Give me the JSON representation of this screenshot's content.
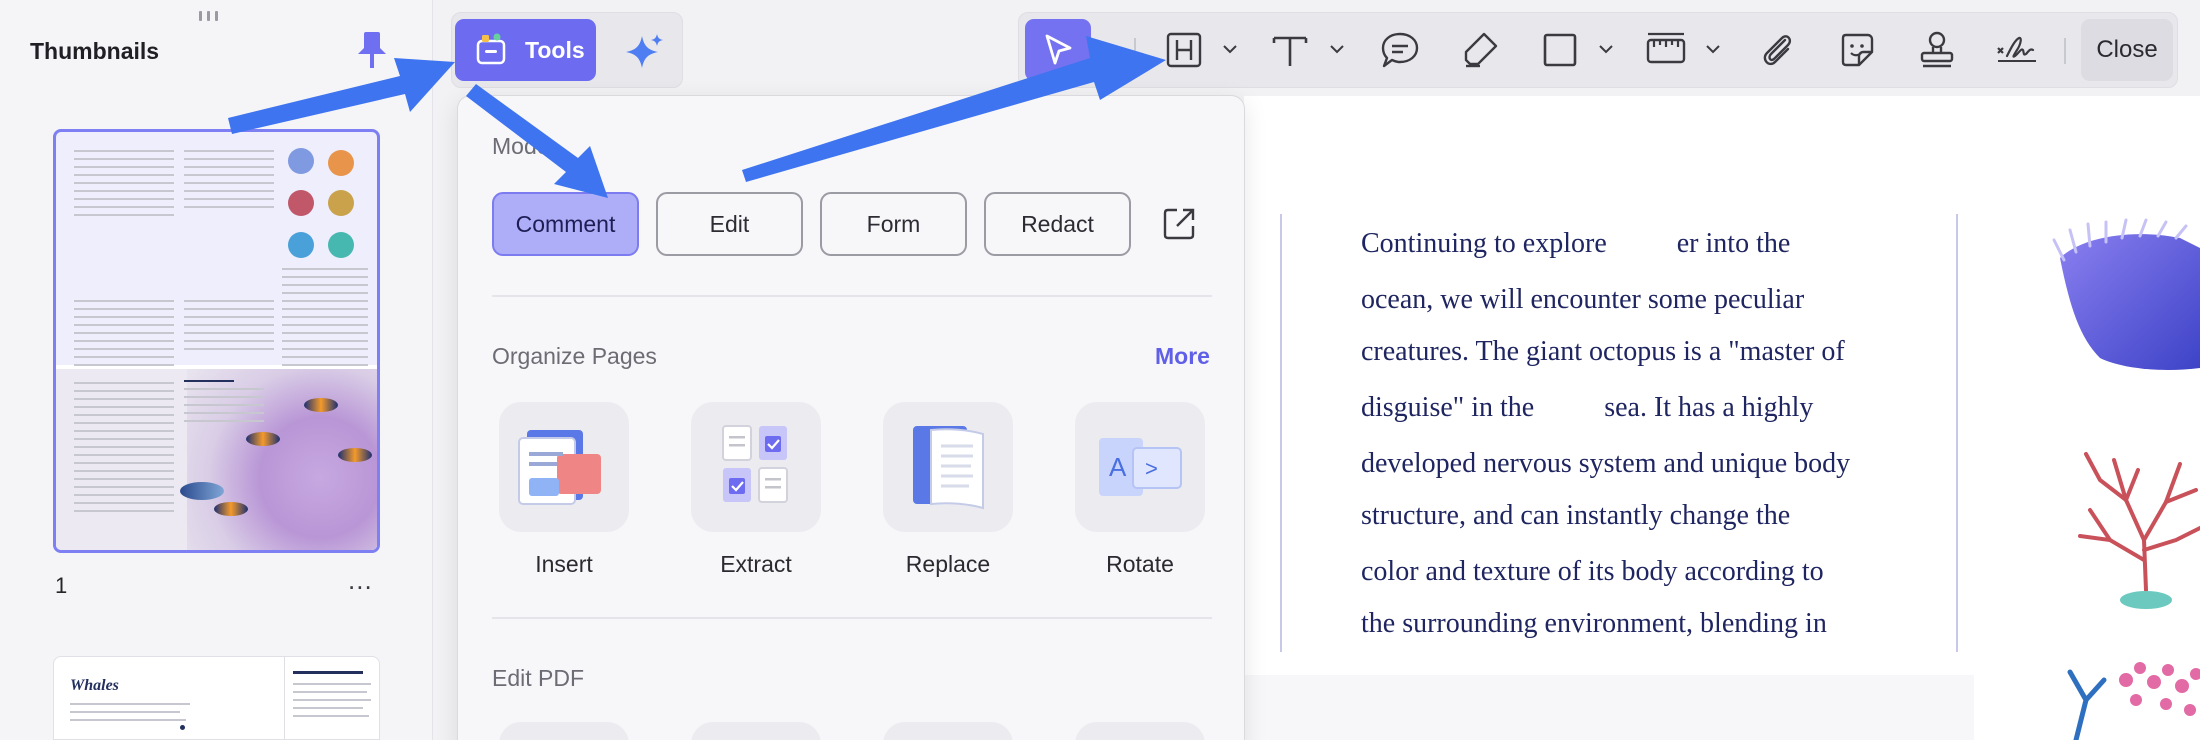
{
  "thumbnails": {
    "title": "Thumbnails",
    "page_number": "1",
    "more": "...",
    "page2_title": "Whales"
  },
  "toolbar": {
    "tools_label": "Tools",
    "close_label": "Close"
  },
  "tools_menu": {
    "mode_title": "Mode",
    "modes": [
      "Comment",
      "Edit",
      "Form",
      "Redact"
    ],
    "active_mode": "Comment",
    "organize_title": "Organize Pages",
    "more_label": "More",
    "organize_items": [
      "Insert",
      "Extract",
      "Replace",
      "Rotate"
    ],
    "edit_title": "Edit PDF"
  },
  "document": {
    "lines": [
      "Continuing to explore          er into the",
      "ocean, we will encounter some peculiar",
      "creatures. The giant octopus is a \"master of",
      "disguise\" in the          sea. It has a highly",
      "developed nervous system and unique body",
      "structure, and can instantly change the",
      "color and texture of its body according to",
      "the surrounding environment, blending in"
    ]
  },
  "colors": {
    "accent": "#6d6cf0",
    "arrow": "#3e74f0",
    "doc_text": "#1f2560"
  }
}
